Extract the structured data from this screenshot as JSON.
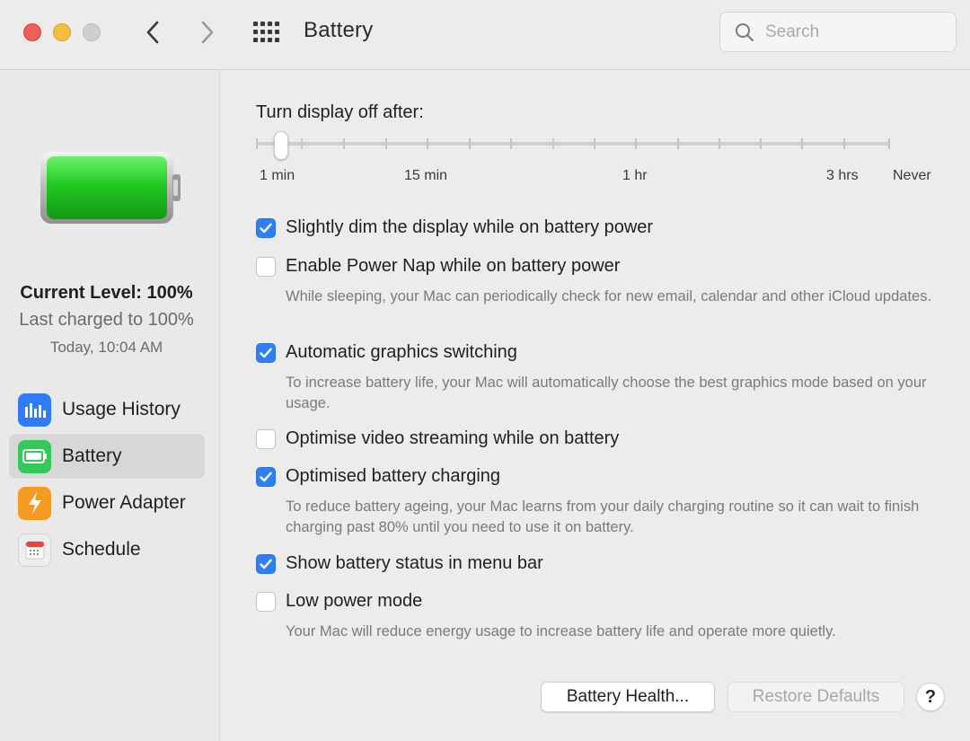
{
  "window": {
    "title": "Battery",
    "search_placeholder": "Search"
  },
  "sidebar": {
    "current_level": "Current Level: 100%",
    "last_charged": "Last charged to 100%",
    "charged_time": "Today, 10:04 AM",
    "battery_level_fraction": 1.0,
    "items": [
      {
        "label": "Usage History",
        "icon": "bar-chart-icon",
        "color": "#2f7cf6"
      },
      {
        "label": "Battery",
        "icon": "battery-icon",
        "color": "#34c759"
      },
      {
        "label": "Power Adapter",
        "icon": "lightning-bolt-icon",
        "color": "#f59a23"
      },
      {
        "label": "Schedule",
        "icon": "calendar-icon",
        "color": "#e8e8e8"
      }
    ],
    "selected_index": 1
  },
  "main": {
    "slider": {
      "title": "Turn display off after:",
      "labels": [
        "1 min",
        "15 min",
        "1 hr",
        "3 hrs",
        "Never"
      ],
      "selected_value": "1 min"
    },
    "options": [
      {
        "label": "Slightly dim the display while on battery power",
        "checked": true,
        "description": ""
      },
      {
        "label": "Enable Power Nap while on battery power",
        "checked": false,
        "description": "While sleeping, your Mac can periodically check for new email, calendar and other iCloud updates."
      },
      {
        "label": "Automatic graphics switching",
        "checked": true,
        "description": "To increase battery life, your Mac will automatically choose the best graphics mode based on your usage."
      },
      {
        "label": "Optimise video streaming while on battery",
        "checked": false,
        "description": ""
      },
      {
        "label": "Optimised battery charging",
        "checked": true,
        "description": "To reduce battery ageing, your Mac learns from your daily charging routine so it can wait to finish charging past 80% until you need to use it on battery."
      },
      {
        "label": "Show battery status in menu bar",
        "checked": true,
        "description": ""
      },
      {
        "label": "Low power mode",
        "checked": false,
        "description": "Your Mac will reduce energy usage to increase battery life and operate more quietly."
      }
    ],
    "buttons": {
      "battery_health": "Battery Health...",
      "restore_defaults": "Restore Defaults",
      "help": "?"
    }
  },
  "colors": {
    "accent": "#2e7ff6",
    "close": "#ee5f57",
    "minimize": "#f6bd3b",
    "battery_fill": "#2fd12f"
  }
}
